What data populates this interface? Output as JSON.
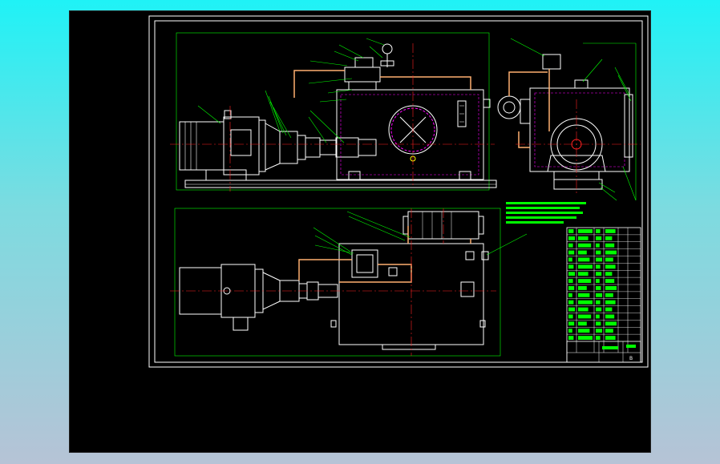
{
  "drawing": {
    "title_block": {
      "sheet": "B",
      "row_count": 16
    },
    "leaders_top": [
      "1",
      "2",
      "3",
      "4",
      "5",
      "6",
      "7",
      "8",
      "9",
      "10",
      "11",
      "12",
      "13"
    ],
    "leaders_plan": [
      "2",
      "3",
      "4",
      "5"
    ],
    "balloon_labels": [
      "8",
      "9",
      "10",
      "11",
      "12",
      "1",
      "2",
      "3"
    ],
    "colors": {
      "frame": "#ffffff",
      "outline": "#ffffff",
      "dimension": "#00ff00",
      "centerline": "#ff2020",
      "hidden": "#ff00ff",
      "pipe": "#ffb070",
      "note": "#00ff00"
    }
  }
}
